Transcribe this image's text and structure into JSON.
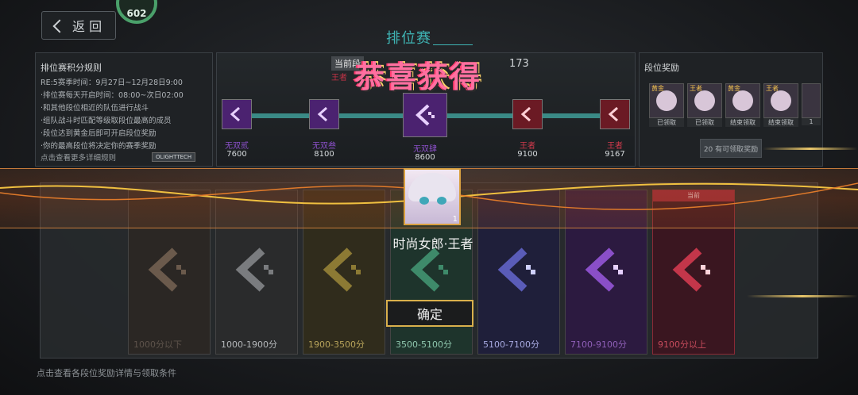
{
  "top_bar": {
    "back_label": "返 回",
    "level": "602",
    "page_title": "排位赛"
  },
  "rules": {
    "title": "排位赛积分规则",
    "items": [
      "RE:5赛季时间：9月27日~12月28日9:00",
      "·排位赛每天开启时间：08:00~次日02:00",
      "·和其他段位相近的队伍进行战斗",
      "·组队战斗时匹配等级取段位最高的成员",
      "·段位达到黄金后即可开启段位奖励",
      "·你的最高段位将决定你的赛季奖励"
    ],
    "link": "点击查看更多详细规则",
    "brand": "OLIGHTTECH"
  },
  "progress": {
    "current_tag": "当前段",
    "current_rank": "王者",
    "current_score": "173",
    "nodes": [
      {
        "label": "无双贰",
        "score": "7600",
        "color": "#8a4fc8"
      },
      {
        "label": "无双叁",
        "score": "8100",
        "color": "#8a4fc8"
      },
      {
        "label": "无双肆",
        "score": "8600",
        "color": "#8a4fc8"
      },
      {
        "label": "王者",
        "score": "9100",
        "color": "#d23a4c"
      },
      {
        "label": "王者",
        "score": "9167",
        "color": "#d23a4c"
      }
    ]
  },
  "rewards": {
    "title": "段位奖励",
    "cards": [
      {
        "tier": "黄金",
        "status": "已领取"
      },
      {
        "tier": "王者",
        "status": "已领取"
      },
      {
        "tier": "黄金",
        "status": "结束领取"
      },
      {
        "tier": "王者",
        "status": "结束领取"
      },
      {
        "tier": "",
        "status": "1"
      }
    ],
    "claim_label": "20 有可领取奖励"
  },
  "tiers": [
    {
      "range": "1000分以下",
      "color": "#5a4a3e"
    },
    {
      "range": "1000-1900分",
      "color": "#55575a"
    },
    {
      "range": "1900-3500分",
      "color": "#6a5e2a"
    },
    {
      "range": "3500-5100分",
      "color": "#2f5a48"
    },
    {
      "range": "5100-7100分",
      "color": "#2e2e5c"
    },
    {
      "range": "7100-9100分",
      "color": "#4b2270"
    },
    {
      "range": "9100分以上",
      "color": "#6b1a24",
      "current": "当前"
    }
  ],
  "overlay": {
    "congrats": "恭喜获得",
    "avatar_count": "1",
    "skin_name": "时尚女郎·王者",
    "confirm_label": "确定"
  },
  "bottom_hint": "点击查看各段位奖励详情与领取条件"
}
